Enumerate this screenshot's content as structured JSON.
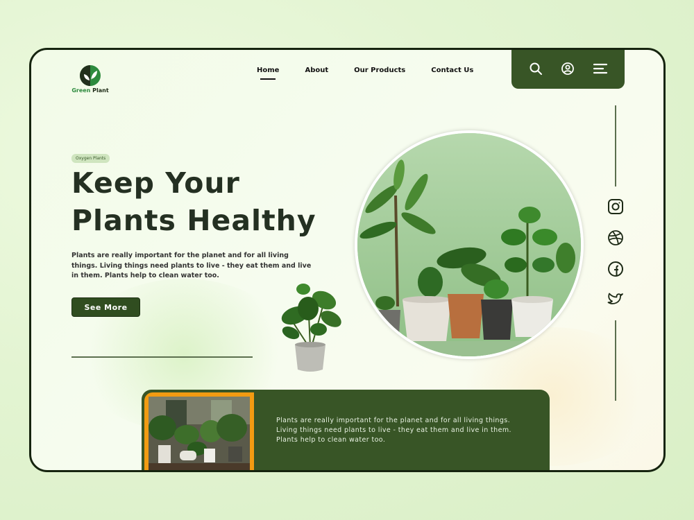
{
  "brand": {
    "name_part1": "Green",
    "name_part2": " Plant"
  },
  "nav": {
    "items": [
      {
        "label": "Home",
        "active": true
      },
      {
        "label": "About",
        "active": false
      },
      {
        "label": "Our Products",
        "active": false
      },
      {
        "label": "Contact Us",
        "active": false
      }
    ]
  },
  "toolbar": {
    "icons": [
      "search-icon",
      "user-icon",
      "menu-icon"
    ]
  },
  "hero": {
    "badge": "Oxygen Plants",
    "title_line1": "Keep Your",
    "title_line2": "Plants Healthy",
    "description": "Plants are really important for the planet and for all living things. Living things need plants to live - they eat them and live in them. Plants help to clean water too.",
    "button_label": "See More"
  },
  "social": {
    "icons": [
      "instagram-icon",
      "dribbble-icon",
      "facebook-icon",
      "twitter-icon"
    ]
  },
  "card": {
    "text": "Plants are really important for the planet and for all living things. Living things need plants to live - they eat them and live in them. Plants help to clean water too."
  },
  "colors": {
    "primary_dark_green": "#385526",
    "button_green": "#304d20",
    "accent_orange": "#f29b12",
    "frame_border": "#16240f",
    "badge_bg": "#cfe5bf"
  }
}
